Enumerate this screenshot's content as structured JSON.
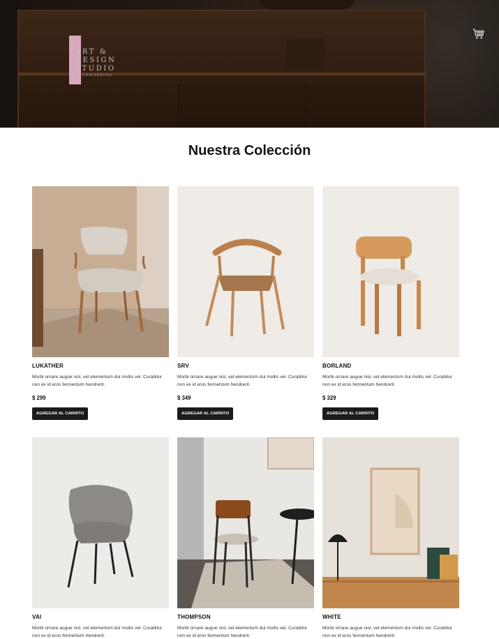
{
  "header": {
    "logo": {
      "line1": "ART &",
      "line2": "DESIGN",
      "line3": "STUDIO",
      "sub": "COWORKING"
    },
    "cart_icon": "shopping-cart-icon"
  },
  "main": {
    "title": "Nuestra Colección",
    "products": [
      {
        "name": "LUKATHER",
        "description": "Morbi ornare augue nisl, vel elementum dui mollis vel. Curabitur non ex id eros fermentum hendrerit.",
        "price": "$ 299",
        "button": "AGREGAR AL CARRITO"
      },
      {
        "name": "SRV",
        "description": "Morbi ornare augue nisl, vel elementum dui mollis vel. Curabitur non ex id eros fermentum hendrerit.",
        "price": "$ 349",
        "button": "AGREGAR AL CARRITO"
      },
      {
        "name": "BORLAND",
        "description": "Morbi ornare augue nisl, vel elementum dui mollis vel. Curabitur non ex id eros fermentum hendrerit.",
        "price": "$ 329",
        "button": "AGREGAR AL CARRITO"
      },
      {
        "name": "VAI",
        "description": "Morbi ornare augue nisl, vel elementum dui mollis vel. Curabitur non ex id eros fermentum hendrerit."
      },
      {
        "name": "THOMPSON",
        "description": "Morbi ornare augue nisl, vel elementum dui mollis vel. Curabitur non ex id eros fermentum hendrerit."
      },
      {
        "name": "WHITE",
        "description": "Morbi ornare augue nisl, vel elementum dui mollis vel. Curabitur non ex id eros fermentum hendrerit."
      }
    ]
  },
  "colors": {
    "button_bg": "#1b1b1b",
    "logo_accent": "#d8a9be"
  }
}
